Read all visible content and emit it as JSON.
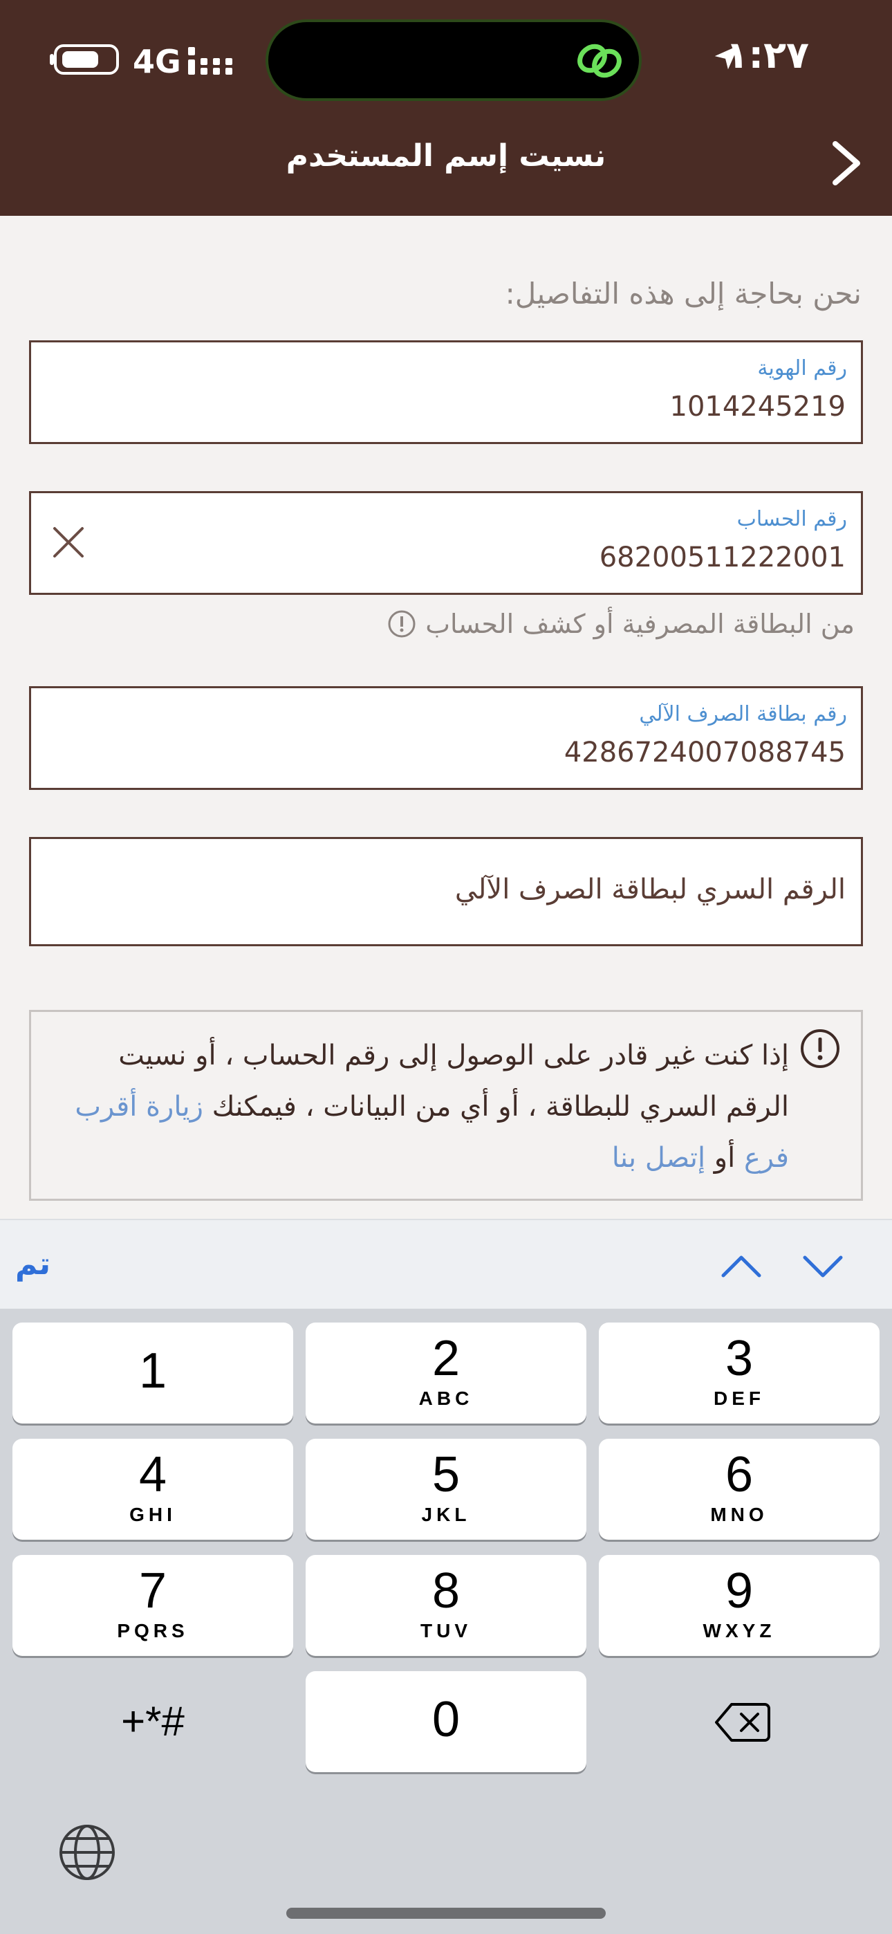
{
  "status_bar": {
    "time": "١:٢٧",
    "network": "4G"
  },
  "header": {
    "title": "نسيت إسم المستخدم"
  },
  "form": {
    "intro": "نحن بحاجة إلى هذه التفاصيل:",
    "id_field": {
      "label": "رقم الهوية",
      "value": "1014245219"
    },
    "account_field": {
      "label": "رقم الحساب",
      "value": "68200511222001"
    },
    "account_hint": "من البطاقة المصرفية أو كشف الحساب",
    "atm_card_field": {
      "label": "رقم بطاقة الصرف الآلي",
      "value": "4286724007088745"
    },
    "pin_field": {
      "placeholder": "الرقم السري لبطاقة الصرف الآلي"
    }
  },
  "info": {
    "text_part1": "إذا كنت غير قادر على الوصول إلى رقم الحساب ، أو نسيت الرقم السري للبطاقة ، أو أي من البيانات ، فيمكنك ",
    "link_visit": "زيارة أقرب فرع",
    "text_or": " أو ",
    "link_contact": "إتصل بنا"
  },
  "keyboard_toolbar": {
    "done_label": "تم"
  },
  "keypad": {
    "keys": [
      {
        "digit": "1",
        "letters": ""
      },
      {
        "digit": "2",
        "letters": "ABC"
      },
      {
        "digit": "3",
        "letters": "DEF"
      },
      {
        "digit": "4",
        "letters": "GHI"
      },
      {
        "digit": "5",
        "letters": "JKL"
      },
      {
        "digit": "6",
        "letters": "MNO"
      },
      {
        "digit": "7",
        "letters": "PQRS"
      },
      {
        "digit": "8",
        "letters": "TUV"
      },
      {
        "digit": "9",
        "letters": "WXYZ"
      },
      {
        "digit": "0",
        "letters": ""
      }
    ],
    "symbols_label": "+*#"
  },
  "colors": {
    "header": "#4a2c25",
    "label_blue": "#4d8fd0",
    "link_blue": "#6b95cf",
    "done_blue": "#2f6fd8"
  }
}
